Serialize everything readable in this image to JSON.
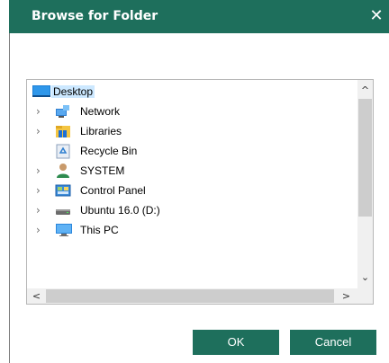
{
  "dialog": {
    "title": "Browse for Folder",
    "close_glyph": "✕"
  },
  "tree": {
    "items": [
      {
        "label": "Desktop",
        "icon": "desktop-icon",
        "expandable": false,
        "selected": true
      },
      {
        "label": "Network",
        "icon": "network-icon",
        "expandable": true
      },
      {
        "label": "Libraries",
        "icon": "libraries-icon",
        "expandable": true
      },
      {
        "label": "Recycle Bin",
        "icon": "recycle-bin-icon",
        "expandable": false
      },
      {
        "label": "SYSTEM",
        "icon": "user-icon",
        "expandable": true
      },
      {
        "label": "Control Panel",
        "icon": "control-panel-icon",
        "expandable": true
      },
      {
        "label": "Ubuntu 16.0 (D:)",
        "icon": "drive-icon",
        "expandable": true
      },
      {
        "label": "This PC",
        "icon": "computer-icon",
        "expandable": true
      }
    ],
    "expander_glyph": "›",
    "scroll_up_glyph": "^",
    "scroll_down_glyph": "⌄",
    "scroll_left_glyph": "<",
    "scroll_right_glyph": ">"
  },
  "buttons": {
    "ok_label": "OK",
    "cancel_label": "Cancel"
  },
  "colors": {
    "accent": "#1e6f5c",
    "selection": "#cce8ff"
  }
}
